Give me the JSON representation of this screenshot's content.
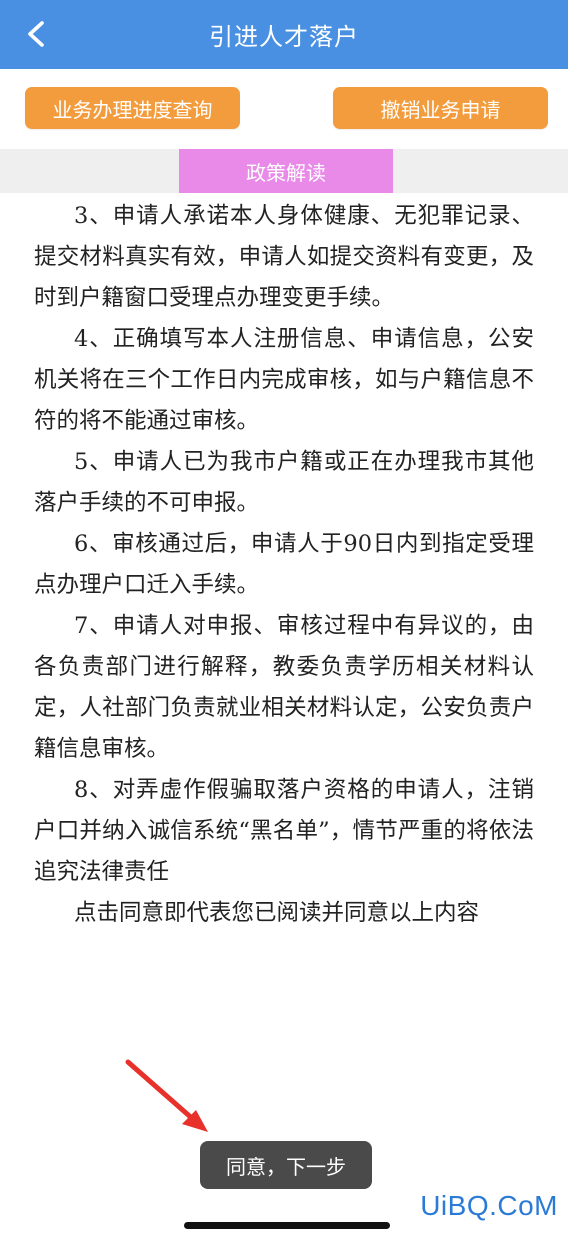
{
  "header": {
    "title": "引进人才落户"
  },
  "actions": {
    "progress_query": "业务办理进度查询",
    "cancel_application": "撤销业务申请"
  },
  "tab": {
    "policy": "政策解读"
  },
  "content": {
    "paragraphs": [
      "3、申请人承诺本人身体健康、无犯罪记录、提交材料真实有效，申请人如提交资料有变更，及时到户籍窗口受理点办理变更手续。",
      "4、正确填写本人注册信息、申请信息，公安机关将在三个工作日内完成审核，如与户籍信息不符的将不能通过审核。",
      "5、申请人已为我市户籍或正在办理我市其他落户手续的不可申报。",
      "6、审核通过后，申请人于90日内到指定受理点办理户口迁入手续。",
      "7、申请人对申报、审核过程中有异议的，由各负责部门进行解释，教委负责学历相关材料认定，人社部门负责就业相关材料认定，公安负责户籍信息审核。",
      "8、对弄虚作假骗取落户资格的申请人，注销户口并纳入诚信系统“黑名单”，情节严重的将依法追究法律责任",
      "点击同意即代表您已阅读并同意以上内容"
    ]
  },
  "footer": {
    "next_label": "同意，下一步"
  },
  "watermark": {
    "text": "UiBQ.CoM"
  },
  "colors": {
    "nav_bg": "#4a90e2",
    "button_orange": "#f39c3d",
    "tab_pink": "#e98ae9",
    "next_button_bg": "#4a4a4a",
    "arrow_red": "#e8312b",
    "watermark_blue": "#2b7bd6"
  },
  "icons": {
    "back": "chevron-left-icon",
    "arrow": "red-arrow-annotation"
  }
}
